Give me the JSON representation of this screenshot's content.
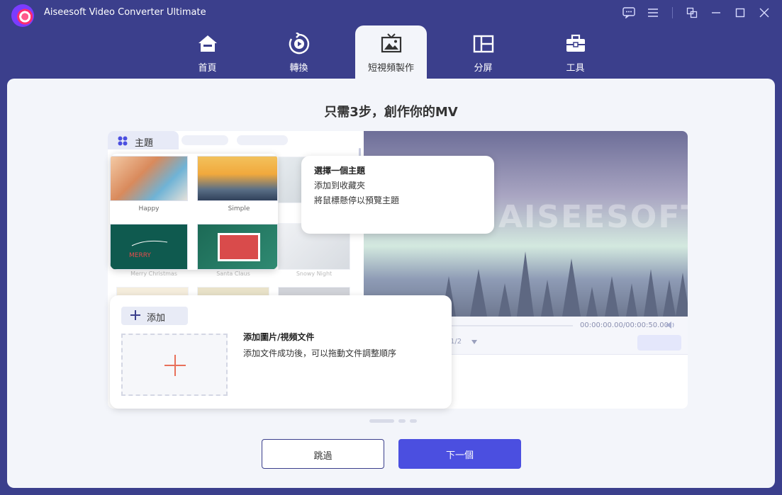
{
  "app": {
    "title": "Aiseesoft Video Converter Ultimate"
  },
  "titlebar_icons": [
    "feedback-icon",
    "menu-icon",
    "toolbox-window-icon",
    "minimize-icon",
    "maximize-icon",
    "close-icon"
  ],
  "tabs": [
    {
      "label": "首頁",
      "icon": "home-icon"
    },
    {
      "label": "轉換",
      "icon": "convert-icon"
    },
    {
      "label": "短視頻製作",
      "icon": "mv-icon",
      "active": true
    },
    {
      "label": "分屏",
      "icon": "collage-icon"
    },
    {
      "label": "工具",
      "icon": "toolbox-icon"
    }
  ],
  "headline": "只需3步，創作你的MV",
  "theme_panel": {
    "tab_label": "主題",
    "themes": [
      {
        "name": "Happy"
      },
      {
        "name": "Simple"
      },
      {
        "name": "Merry Christmas"
      },
      {
        "name": "Santa Claus"
      },
      {
        "name": "Snowy Night"
      }
    ]
  },
  "tip": {
    "title": "選擇一個主題",
    "line1": "添加到收藏夾",
    "line2": "將鼠標懸停以預覽主題"
  },
  "preview": {
    "watermark": "AISEESOFT",
    "time": "00:00:00.00/00:00:50.00",
    "page": "1/2"
  },
  "add_step": {
    "button_label": "添加",
    "title": "添加圖片/視頻文件",
    "description": "添加文件成功後，可以拖動文件調整順序"
  },
  "buttons": {
    "skip": "跳過",
    "next": "下一個"
  },
  "colors": {
    "header": "#3b3f8c",
    "accent": "#4b4fe0",
    "panel": "#f3f5fa"
  }
}
